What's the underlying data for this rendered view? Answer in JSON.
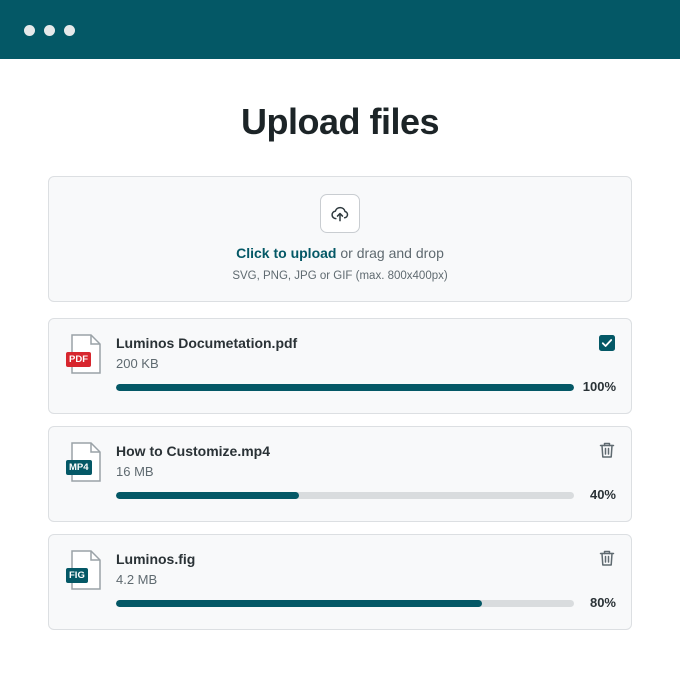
{
  "window": {
    "titlebar_color": "#045866"
  },
  "page": {
    "title": "Upload files"
  },
  "dropzone": {
    "link_text": "Click to upload",
    "rest_text": " or drag and drop",
    "hint": "SVG, PNG, JPG or GIF (max. 800x400px)",
    "icon": "upload-cloud-icon"
  },
  "files": [
    {
      "name": "Luminos Documetation.pdf",
      "size": "200 KB",
      "badge": "PDF",
      "badge_color": "#d7262e",
      "progress": 1.0,
      "progress_label": "100%",
      "status": "complete",
      "action_icon": "checkbox-checked-icon"
    },
    {
      "name": "How to Customize.mp4",
      "size": "16 MB",
      "badge": "MP4",
      "badge_color": "#045866",
      "progress": 0.4,
      "progress_label": "40%",
      "status": "uploading",
      "action_icon": "trash-icon"
    },
    {
      "name": "Luminos.fig",
      "size": "4.2 MB",
      "badge": "FIG",
      "badge_color": "#045866",
      "progress": 0.8,
      "progress_label": "80%",
      "status": "uploading",
      "action_icon": "trash-icon"
    }
  ],
  "colors": {
    "accent": "#045866",
    "track": "#d9dcde",
    "pdf_badge": "#d7262e"
  }
}
